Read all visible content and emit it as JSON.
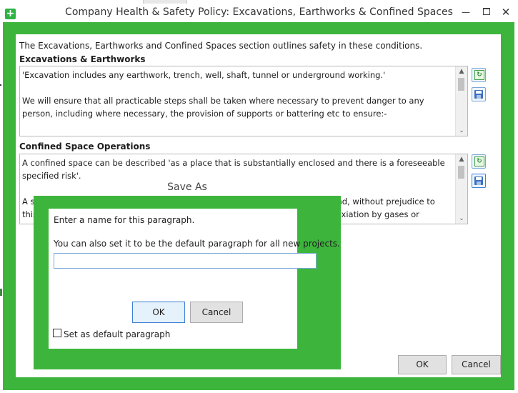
{
  "window": {
    "title": "Company Health & Safety Policy: Excavations, Earthworks & Confined Spaces",
    "app_icon": "plus-icon",
    "minimize_glyph": "—",
    "close_glyph": "✕"
  },
  "intro": "The Excavations, Earthworks and Confined Spaces section outlines safety in these conditions.",
  "sections": [
    {
      "heading": "Excavations & Earthworks",
      "text": "'Excavation includes any earthwork, trench, well, shaft, tunnel or underground working.'\n\nWe will ensure that all practicable steps shall be taken where necessary to prevent danger to any person, including where necessary, the provision of supports or battering etc to ensure:-\n\n- Any excavation or part, does not collapse."
    },
    {
      "heading": "Confined Space Operations",
      "text": "A confined space can be described 'as a place that is substantially enclosed and there is a foreseeable specified risk'.\n\nA sp                                                                                                          ion and, without prejudice to\nthis                                                                                                           asphyxiation by gases or\noxy                                                                                                           sphyxiation by solid materials\nwhi                                                                                                            reach safety unaided'."
    }
  ],
  "buttons": {
    "ok": "OK",
    "cancel": "Cancel"
  },
  "scroll": {
    "up": "▲",
    "down": "⌄"
  },
  "icons": {
    "refresh": "refresh-icon",
    "save": "save-disk-icon"
  },
  "dialog": {
    "title": "Save As",
    "prompt": "Enter a name for this paragraph.",
    "subprompt": "You can also set it to be the default paragraph for all new projects.",
    "name_value": "",
    "ok": "OK",
    "cancel": "Cancel",
    "checkbox_label": "Set as default paragraph",
    "checkbox_checked": false
  },
  "colors": {
    "frame_green": "#3db53d",
    "accent_blue": "#3c7fd6"
  }
}
